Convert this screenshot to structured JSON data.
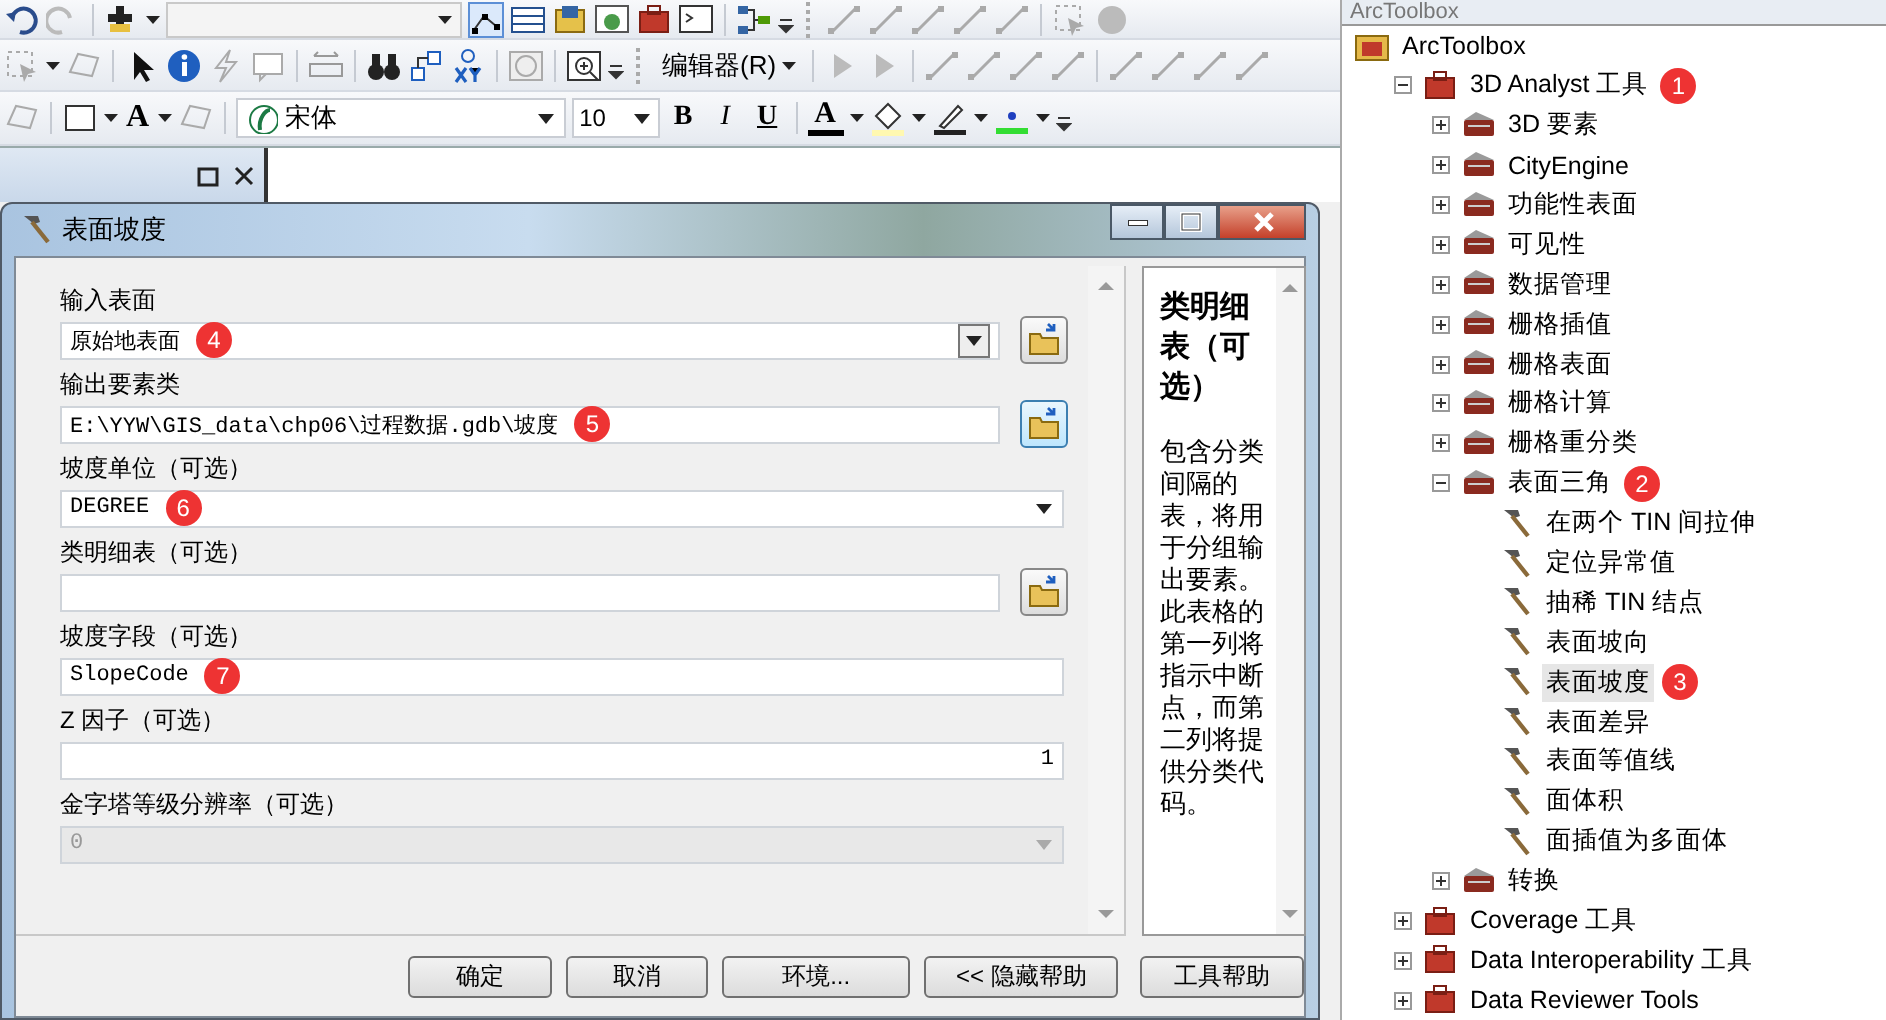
{
  "toolbar": {
    "editor_menu": "编辑器(R)",
    "text_tool": "A",
    "font_field": "宋体",
    "size_field": "10",
    "format_buttons": [
      {
        "label": "B",
        "kind": "bold"
      },
      {
        "label": "I",
        "kind": "italic"
      },
      {
        "label": "U",
        "kind": "underline"
      }
    ],
    "font_color": "A"
  },
  "dialog": {
    "title": "表面坡度",
    "parameters": [
      {
        "label": "输入表面",
        "kind": "combo",
        "value": "原始地表面",
        "badge": "4",
        "browse": true,
        "disabled": false
      },
      {
        "label": "输出要素类",
        "kind": "text",
        "value": "E:\\YYW\\GIS_data\\chp06\\过程数据.gdb\\坡度",
        "badge": "5",
        "browse": true,
        "disabled": false
      },
      {
        "label": "坡度单位（可选）",
        "kind": "dropdown",
        "value": "DEGREE",
        "badge": "6",
        "browse": false,
        "disabled": false
      },
      {
        "label": "类明细表（可选）",
        "kind": "text",
        "browse": true,
        "disabled": false
      },
      {
        "label": "坡度字段（可选）",
        "kind": "text",
        "value": "SlopeCode",
        "badge": "7",
        "browse": false,
        "disabled": false
      },
      {
        "label": "Z 因子（可选）",
        "kind": "number",
        "value": "1",
        "browse": false,
        "disabled": false
      },
      {
        "label": "金字塔等级分辨率（可选）",
        "kind": "dropdown",
        "value": "0",
        "browse": false,
        "disabled": true
      }
    ],
    "help": {
      "title": "类明细表（可选）",
      "body": "包含分类间隔的表，将用于分组输出要素。此表格的第一列将指示中断点，而第二列将提供分类代码。"
    },
    "buttons": [
      "确定",
      "取消",
      "环境...",
      "<< 隐藏帮助",
      "工具帮助"
    ]
  },
  "toolbox": {
    "title": "ArcToolbox",
    "tree": [
      {
        "label": "ArcToolbox",
        "kind": "root",
        "selected": false,
        "children": [
          {
            "label": "3D Analyst 工具",
            "kind": "toolbox",
            "expanded": true,
            "selected": false,
            "badge": "1",
            "children": [
              {
                "label": "3D 要素",
                "kind": "toolset",
                "expanded": false,
                "selected": false
              },
              {
                "label": "CityEngine",
                "kind": "toolset",
                "expanded": false,
                "selected": false
              },
              {
                "label": "功能性表面",
                "kind": "toolset",
                "expanded": false,
                "selected": false
              },
              {
                "label": "可见性",
                "kind": "toolset",
                "expanded": false,
                "selected": false
              },
              {
                "label": "数据管理",
                "kind": "toolset",
                "expanded": false,
                "selected": false
              },
              {
                "label": "栅格插值",
                "kind": "toolset",
                "expanded": false,
                "selected": false
              },
              {
                "label": "栅格表面",
                "kind": "toolset",
                "expanded": false,
                "selected": false
              },
              {
                "label": "栅格计算",
                "kind": "toolset",
                "expanded": false,
                "selected": false
              },
              {
                "label": "栅格重分类",
                "kind": "toolset",
                "expanded": false,
                "selected": false
              },
              {
                "label": "表面三角",
                "kind": "toolset",
                "expanded": true,
                "selected": false,
                "badge": "2",
                "children": [
                  {
                    "label": "在两个 TIN 间拉伸",
                    "kind": "tool",
                    "selected": false
                  },
                  {
                    "label": "定位异常值",
                    "kind": "tool",
                    "selected": false
                  },
                  {
                    "label": "抽稀 TIN 结点",
                    "kind": "tool",
                    "selected": false
                  },
                  {
                    "label": "表面坡向",
                    "kind": "tool",
                    "selected": false
                  },
                  {
                    "label": "表面坡度",
                    "kind": "tool",
                    "selected": true,
                    "badge": "3"
                  },
                  {
                    "label": "表面差异",
                    "kind": "tool",
                    "selected": false
                  },
                  {
                    "label": "表面等值线",
                    "kind": "tool",
                    "selected": false
                  },
                  {
                    "label": "面体积",
                    "kind": "tool",
                    "selected": false
                  },
                  {
                    "label": "面插值为多面体",
                    "kind": "tool",
                    "selected": false
                  }
                ]
              },
              {
                "label": "转换",
                "kind": "toolset",
                "expanded": false,
                "selected": false
              }
            ]
          },
          {
            "label": "Coverage 工具",
            "kind": "toolbox",
            "expanded": false,
            "selected": false
          },
          {
            "label": "Data Interoperability 工具",
            "kind": "toolbox",
            "expanded": false,
            "selected": false
          },
          {
            "label": "Data Reviewer Tools",
            "kind": "toolbox",
            "expanded": false,
            "selected": false
          }
        ]
      }
    ]
  }
}
